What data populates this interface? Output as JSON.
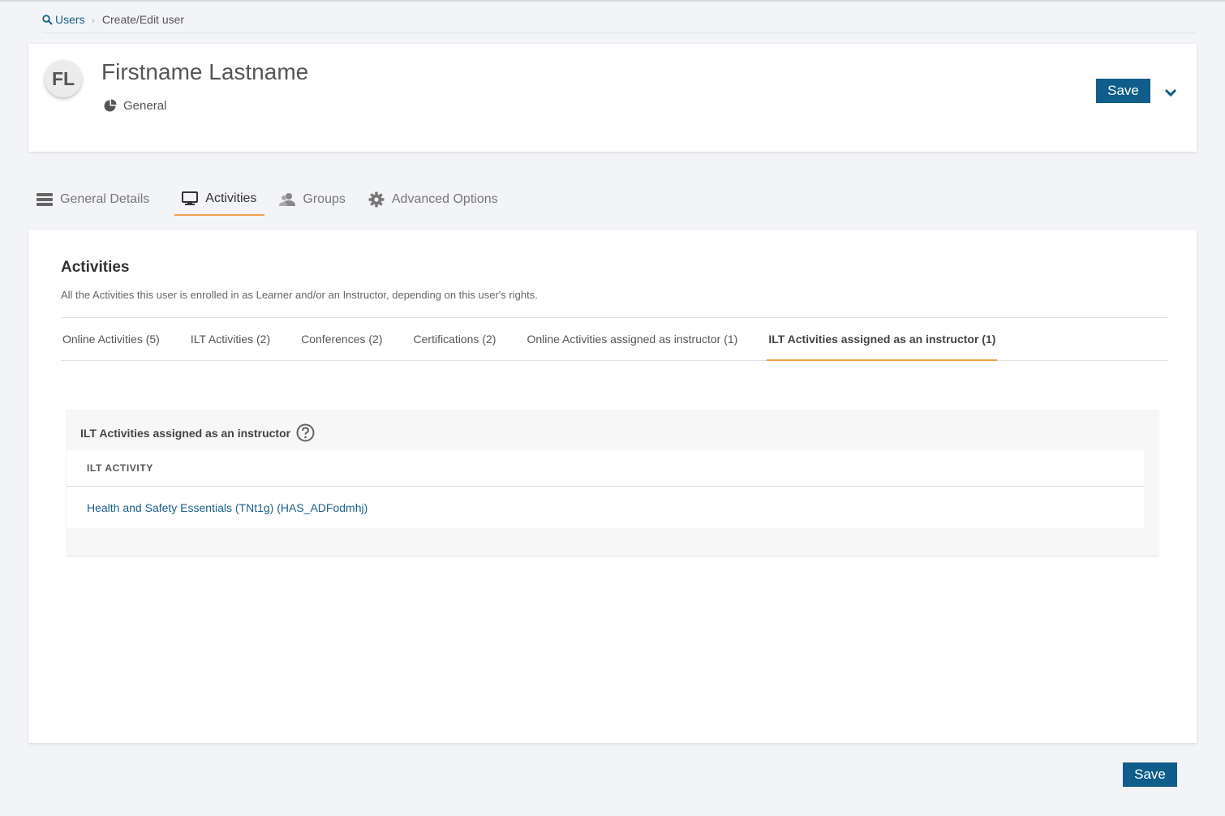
{
  "breadcrumb": {
    "root": "Users",
    "current": "Create/Edit user"
  },
  "header": {
    "initials": "FL",
    "name": "Firstname Lastname",
    "user_type": "General",
    "save_label": "Save"
  },
  "main_tabs": [
    {
      "label": "General Details",
      "icon": "list-icon"
    },
    {
      "label": "Activities",
      "icon": "monitor-icon",
      "active": true
    },
    {
      "label": "Groups",
      "icon": "users-icon"
    },
    {
      "label": "Advanced Options",
      "icon": "gear-icon"
    }
  ],
  "activities": {
    "title": "Activities",
    "description": "All the Activities this user is enrolled in as Learner and/or an Instructor, depending on this user's rights.",
    "sub_tabs": [
      {
        "label": "Online Activities (5)"
      },
      {
        "label": "ILT Activities (2)"
      },
      {
        "label": "Conferences (2)"
      },
      {
        "label": "Certifications (2)"
      },
      {
        "label": "Online Activities assigned as instructor (1)"
      },
      {
        "label": "ILT Activities assigned as an instructor (1)",
        "active": true
      }
    ],
    "panel": {
      "title": "ILT Activities assigned as an instructor",
      "column_header": "ILT ACTIVITY",
      "rows": [
        "Health and Safety Essentials (TNt1g) (HAS_ADFodmhj)"
      ]
    }
  },
  "footer": {
    "save_label": "Save"
  },
  "colors": {
    "primary_button": "#0e5d8a",
    "link": "#1a5f8c",
    "active_tab_underline": "#f0a04b",
    "page_background": "#f3f4f7"
  }
}
